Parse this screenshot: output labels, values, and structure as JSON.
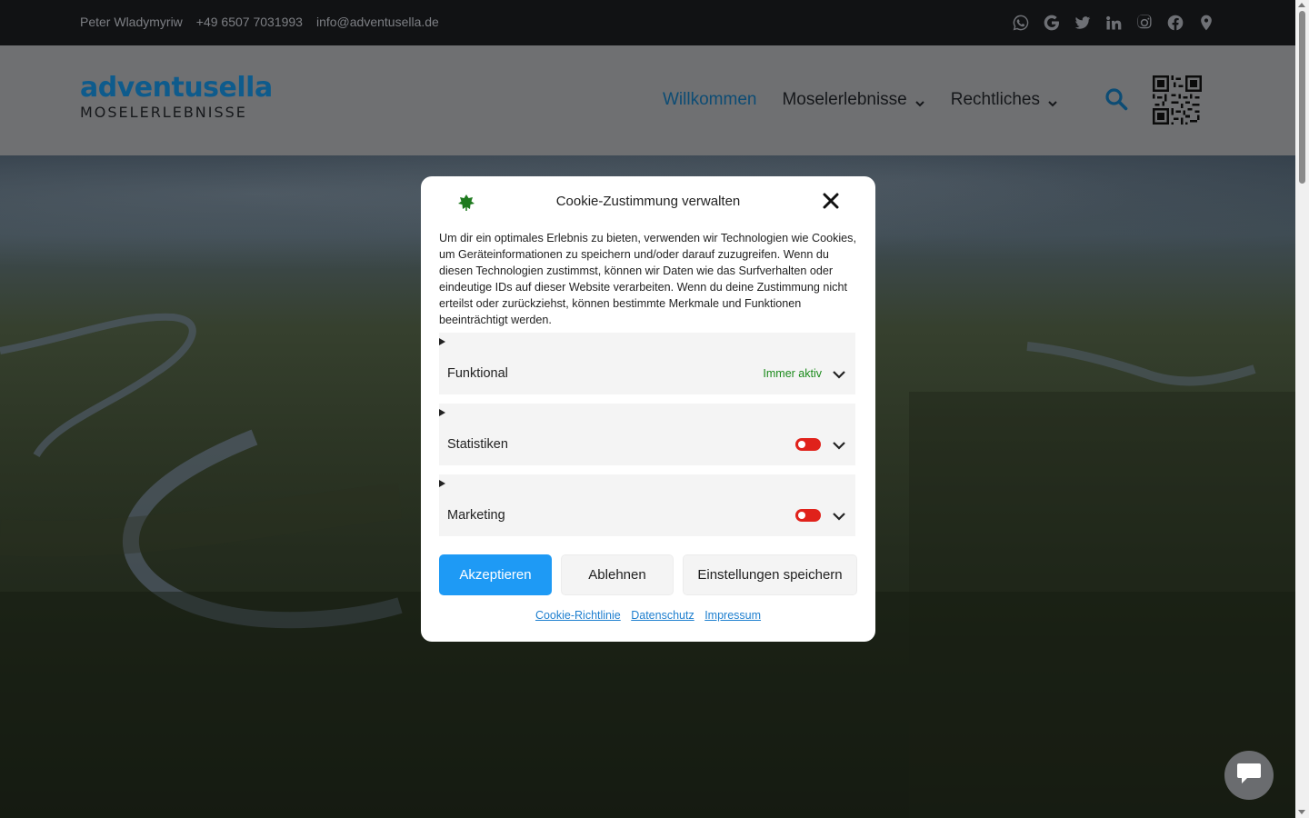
{
  "topbar": {
    "contact_name": "Peter Wladymyriw",
    "phone": "+49 6507 7031993",
    "email": "info@adventusella.de",
    "social_icons": [
      "whatsapp-icon",
      "google-icon",
      "twitter-icon",
      "linkedin-icon",
      "instagram-icon",
      "facebook-icon",
      "map-pin-icon"
    ]
  },
  "header": {
    "brand": "adventusella",
    "tagline": "MOSELERLEBNISSE",
    "nav": [
      {
        "label": "Willkommen",
        "active": true
      },
      {
        "label": "Moselerlebnisse",
        "dropdown": true
      },
      {
        "label": "Rechtliches",
        "dropdown": true
      }
    ],
    "accent_color": "#0d4c74"
  },
  "modal": {
    "title": "Cookie-Zustimmung verwalten",
    "description": "Um dir ein optimales Erlebnis zu bieten, verwenden wir Technologien wie Cookies, um Geräteinformationen zu speichern und/oder darauf zuzugreifen. Wenn du diesen Technologien zustimmst, können wir Daten wie das Surfverhalten oder eindeutige IDs auf dieser Website verarbeiten. Wenn du deine Zustimmung nicht erteilst oder zurückziehst, können bestimmte Merkmale und Funktionen beeinträchtigt werden.",
    "categories": [
      {
        "label": "Funktional",
        "status": "Immer aktiv"
      },
      {
        "label": "Statistiken",
        "enabled": false
      },
      {
        "label": "Marketing",
        "enabled": false
      }
    ],
    "buttons": {
      "accept": "Akzeptieren",
      "deny": "Ablehnen",
      "save": "Einstellungen speichern"
    },
    "links": [
      "Cookie-Richtlinie",
      "Datenschutz",
      "Impressum"
    ],
    "accept_color": "#1e9af5",
    "toggle_off_color": "#e0221b"
  }
}
